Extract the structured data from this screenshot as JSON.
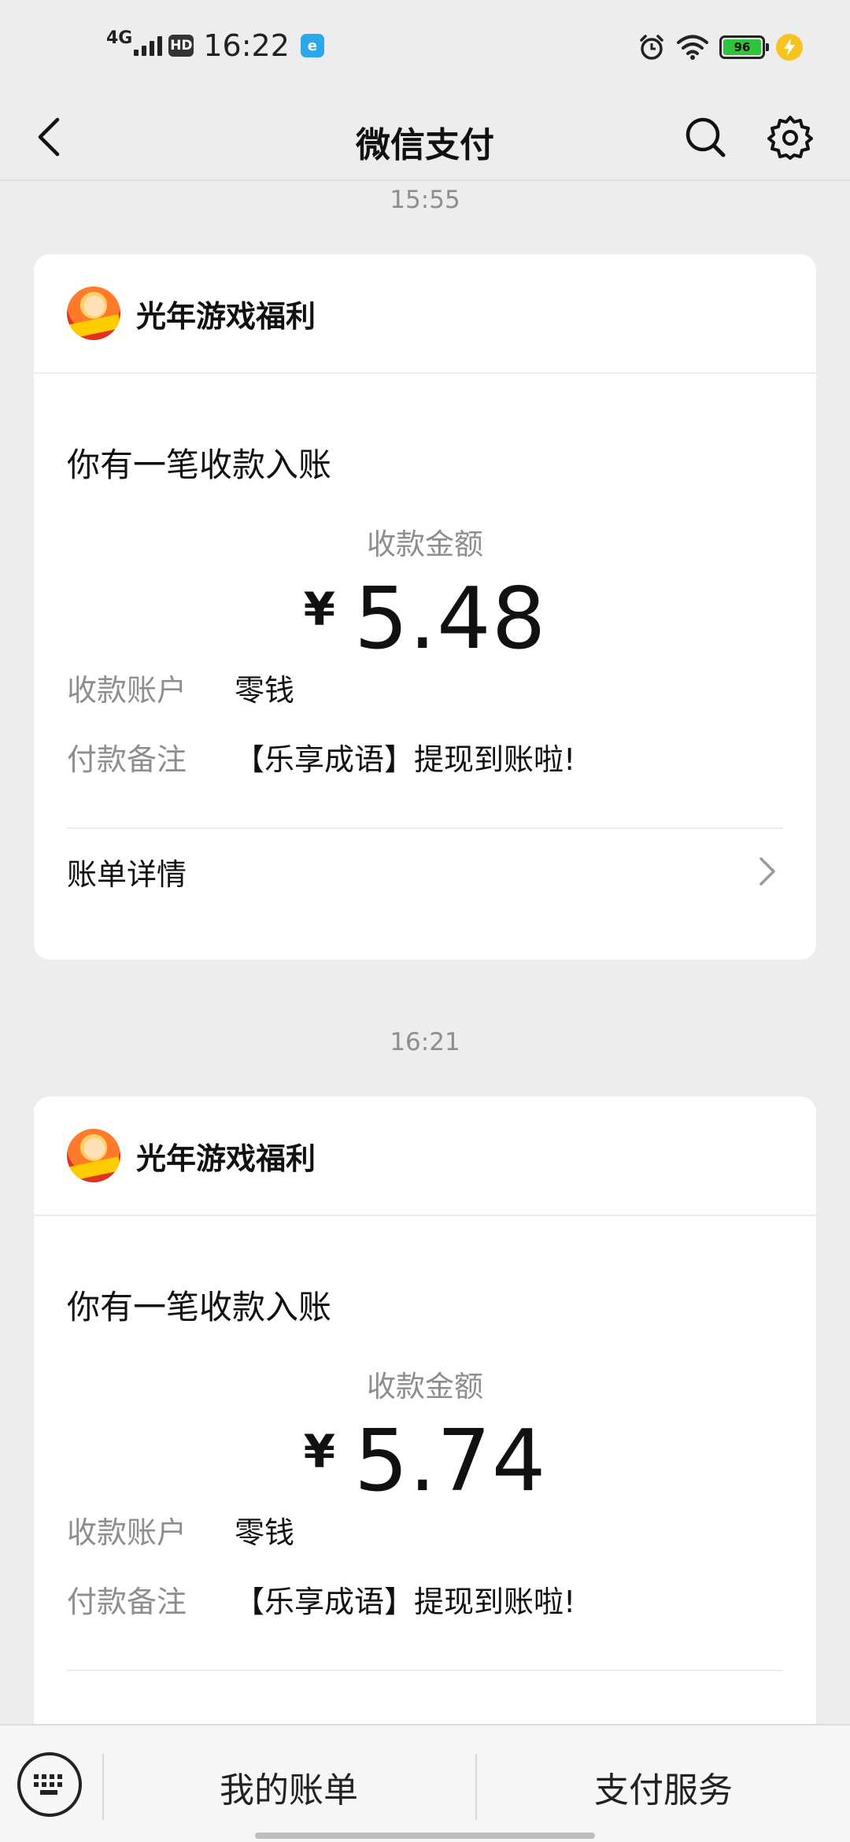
{
  "status_bar": {
    "network": "4G",
    "hd": "HD",
    "time": "16:22",
    "app_badge": "e",
    "battery": "96",
    "icons": [
      "alarm-icon",
      "wifi-icon",
      "battery-icon",
      "charging-icon"
    ]
  },
  "nav": {
    "title": "微信支付",
    "icons": [
      "back-arrow-icon",
      "search-icon",
      "gear-icon"
    ]
  },
  "messages": [
    {
      "timestamp": "15:55",
      "sender": "光年游戏福利",
      "notice_title": "你有一笔收款入账",
      "amount_label": "收款金额",
      "currency": "¥",
      "amount": "5.48",
      "account_label": "收款账户",
      "account_value": "零钱",
      "remark_label": "付款备注",
      "remark_value": "【乐享成语】提现到账啦!",
      "detail_label": "账单详情"
    },
    {
      "timestamp": "16:21",
      "sender": "光年游戏福利",
      "notice_title": "你有一笔收款入账",
      "amount_label": "收款金额",
      "currency": "¥",
      "amount": "5.74",
      "account_label": "收款账户",
      "account_value": "零钱",
      "remark_label": "付款备注",
      "remark_value": "【乐享成语】提现到账啦!"
    }
  ],
  "bottom_bar": {
    "items": [
      "我的账单",
      "支付服务"
    ],
    "icons": [
      "keyboard-icon"
    ]
  },
  "colors": {
    "background": "#ededed",
    "card": "#ffffff",
    "muted_text": "#8e8e8e",
    "battery": "#2fc53a",
    "charge": "#f6c420"
  }
}
